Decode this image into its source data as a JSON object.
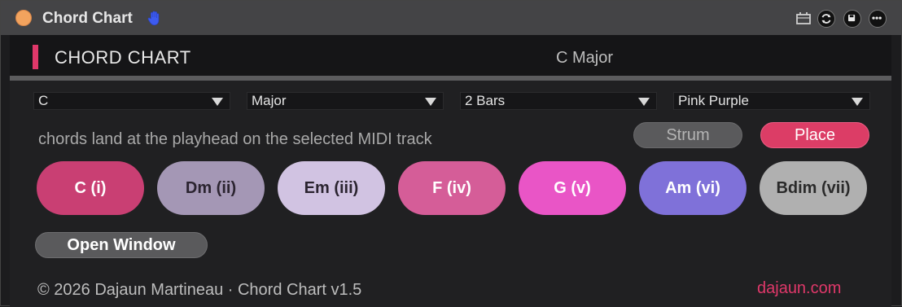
{
  "window": {
    "title": "Chord Chart",
    "status_dot_color": "#f2a35e",
    "icons": [
      "hand-icon",
      "clip-icon",
      "sync-icon",
      "save-icon",
      "more-icon"
    ]
  },
  "header": {
    "title": "CHORD CHART",
    "key_display": "C Major",
    "accent_color": "#e0386a"
  },
  "controls": {
    "root": {
      "value": "C"
    },
    "scale": {
      "value": "Major"
    },
    "length": {
      "value": "2 Bars"
    },
    "palette": {
      "value": "Pink Purple"
    }
  },
  "hint": "chords land at the playhead on the selected MIDI track",
  "buttons": {
    "strum": "Strum",
    "place": "Place",
    "open_window": "Open Window"
  },
  "chords": [
    {
      "label": "C (i)",
      "color": "#c93f73",
      "text_color": "#ffffff"
    },
    {
      "label": "Dm (ii)",
      "color": "#a497b5",
      "text_color": "#2b2430"
    },
    {
      "label": "Em (iii)",
      "color": "#d1c3e2",
      "text_color": "#2b2430"
    },
    {
      "label": "F (iv)",
      "color": "#d55d98",
      "text_color": "#ffffff"
    },
    {
      "label": "G (v)",
      "color": "#e955c6",
      "text_color": "#ffffff"
    },
    {
      "label": "Am (vi)",
      "color": "#7f71d9",
      "text_color": "#ffffff"
    },
    {
      "label": "Bdim (vii)",
      "color": "#b0b0b0",
      "text_color": "#2a2a2a"
    }
  ],
  "footer": {
    "copyright": "© 2026 Dajaun Martineau · Chord Chart v1.5",
    "link": "dajaun.com"
  }
}
